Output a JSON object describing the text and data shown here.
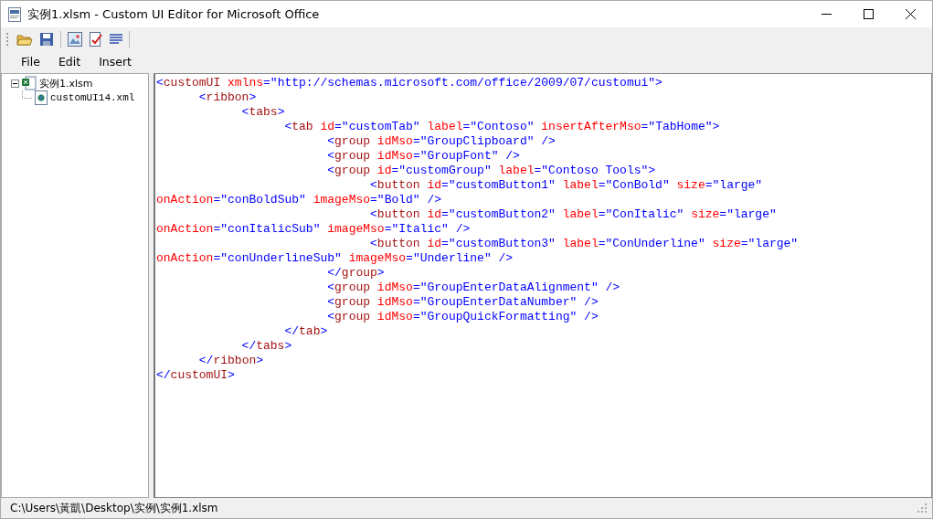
{
  "window": {
    "title": "实例1.xlsm - Custom UI Editor for Microsoft Office"
  },
  "menu": [
    "File",
    "Edit",
    "Insert"
  ],
  "tree": [
    {
      "label": "实例1.xlsm",
      "expanded": true,
      "children": [
        {
          "label": "customUI14.xml"
        }
      ]
    }
  ],
  "code_lines": [
    [
      {
        "kind": "punct",
        "text": "<"
      },
      {
        "kind": "tag",
        "text": "customUI"
      },
      {
        "kind": "attr",
        "text": " xmlns"
      },
      {
        "kind": "punct",
        "text": "=\"http://schemas.microsoft.com/office/2009/07/customui\">"
      }
    ],
    [
      {
        "kind": "punct",
        "text": "      <"
      },
      {
        "kind": "tag",
        "text": "ribbon"
      },
      {
        "kind": "punct",
        "text": ">"
      }
    ],
    [
      {
        "kind": "punct",
        "text": "            <"
      },
      {
        "kind": "tag",
        "text": "tabs"
      },
      {
        "kind": "punct",
        "text": ">"
      }
    ],
    [
      {
        "kind": "punct",
        "text": "                  <"
      },
      {
        "kind": "tag",
        "text": "tab"
      },
      {
        "kind": "attr",
        "text": " id"
      },
      {
        "kind": "punct",
        "text": "=\"customTab\""
      },
      {
        "kind": "attr",
        "text": " label"
      },
      {
        "kind": "punct",
        "text": "=\"Contoso\""
      },
      {
        "kind": "attr",
        "text": " insertAfterMso"
      },
      {
        "kind": "punct",
        "text": "=\"TabHome\">"
      }
    ],
    [
      {
        "kind": "punct",
        "text": "                        <"
      },
      {
        "kind": "tag",
        "text": "group"
      },
      {
        "kind": "attr",
        "text": " idMso"
      },
      {
        "kind": "punct",
        "text": "=\"GroupClipboard\" />"
      }
    ],
    [
      {
        "kind": "punct",
        "text": "                        <"
      },
      {
        "kind": "tag",
        "text": "group"
      },
      {
        "kind": "attr",
        "text": " idMso"
      },
      {
        "kind": "punct",
        "text": "=\"GroupFont\" />"
      }
    ],
    [
      {
        "kind": "punct",
        "text": "                        <"
      },
      {
        "kind": "tag",
        "text": "group"
      },
      {
        "kind": "attr",
        "text": " id"
      },
      {
        "kind": "punct",
        "text": "=\"customGroup\""
      },
      {
        "kind": "attr",
        "text": " label"
      },
      {
        "kind": "punct",
        "text": "=\"Contoso Tools\">"
      }
    ],
    [
      {
        "kind": "punct",
        "text": "                              <"
      },
      {
        "kind": "tag",
        "text": "button"
      },
      {
        "kind": "attr",
        "text": " id"
      },
      {
        "kind": "punct",
        "text": "=\"customButton1\""
      },
      {
        "kind": "attr",
        "text": " label"
      },
      {
        "kind": "punct",
        "text": "=\"ConBold\""
      },
      {
        "kind": "attr",
        "text": " size"
      },
      {
        "kind": "punct",
        "text": "=\"large\""
      }
    ],
    [
      {
        "kind": "attr",
        "text": "onAction"
      },
      {
        "kind": "punct",
        "text": "=\"conBoldSub\""
      },
      {
        "kind": "attr",
        "text": " imageMso"
      },
      {
        "kind": "punct",
        "text": "=\"Bold\" />"
      }
    ],
    [
      {
        "kind": "punct",
        "text": "                              <"
      },
      {
        "kind": "tag",
        "text": "button"
      },
      {
        "kind": "attr",
        "text": " id"
      },
      {
        "kind": "punct",
        "text": "=\"customButton2\""
      },
      {
        "kind": "attr",
        "text": " label"
      },
      {
        "kind": "punct",
        "text": "=\"ConItalic\""
      },
      {
        "kind": "attr",
        "text": " size"
      },
      {
        "kind": "punct",
        "text": "=\"large\""
      }
    ],
    [
      {
        "kind": "attr",
        "text": "onAction"
      },
      {
        "kind": "punct",
        "text": "=\"conItalicSub\""
      },
      {
        "kind": "attr",
        "text": " imageMso"
      },
      {
        "kind": "punct",
        "text": "=\"Italic\" />"
      }
    ],
    [
      {
        "kind": "punct",
        "text": "                              <"
      },
      {
        "kind": "tag",
        "text": "button"
      },
      {
        "kind": "attr",
        "text": " id"
      },
      {
        "kind": "punct",
        "text": "=\"customButton3\""
      },
      {
        "kind": "attr",
        "text": " label"
      },
      {
        "kind": "punct",
        "text": "=\"ConUnderline\""
      },
      {
        "kind": "attr",
        "text": " size"
      },
      {
        "kind": "punct",
        "text": "=\"large\""
      }
    ],
    [
      {
        "kind": "attr",
        "text": "onAction"
      },
      {
        "kind": "punct",
        "text": "=\"conUnderlineSub\""
      },
      {
        "kind": "attr",
        "text": " imageMso"
      },
      {
        "kind": "punct",
        "text": "=\"Underline\" />"
      }
    ],
    [
      {
        "kind": "punct",
        "text": "                        </"
      },
      {
        "kind": "tag",
        "text": "group"
      },
      {
        "kind": "punct",
        "text": ">"
      }
    ],
    [
      {
        "kind": "punct",
        "text": "                        <"
      },
      {
        "kind": "tag",
        "text": "group"
      },
      {
        "kind": "attr",
        "text": " idMso"
      },
      {
        "kind": "punct",
        "text": "=\"GroupEnterDataAlignment\" />"
      }
    ],
    [
      {
        "kind": "punct",
        "text": "                        <"
      },
      {
        "kind": "tag",
        "text": "group"
      },
      {
        "kind": "attr",
        "text": " idMso"
      },
      {
        "kind": "punct",
        "text": "=\"GroupEnterDataNumber\" />"
      }
    ],
    [
      {
        "kind": "punct",
        "text": "                        <"
      },
      {
        "kind": "tag",
        "text": "group"
      },
      {
        "kind": "attr",
        "text": " idMso"
      },
      {
        "kind": "punct",
        "text": "=\"GroupQuickFormatting\" />"
      }
    ],
    [
      {
        "kind": "punct",
        "text": "                  </"
      },
      {
        "kind": "tag",
        "text": "tab"
      },
      {
        "kind": "punct",
        "text": ">"
      }
    ],
    [
      {
        "kind": "punct",
        "text": "            </"
      },
      {
        "kind": "tag",
        "text": "tabs"
      },
      {
        "kind": "punct",
        "text": ">"
      }
    ],
    [
      {
        "kind": "punct",
        "text": "      </"
      },
      {
        "kind": "tag",
        "text": "ribbon"
      },
      {
        "kind": "punct",
        "text": ">"
      }
    ],
    [
      {
        "kind": "punct",
        "text": "</"
      },
      {
        "kind": "tag",
        "text": "customUI"
      },
      {
        "kind": "punct",
        "text": ">"
      }
    ]
  ],
  "status_bar": "C:\\Users\\黃凱\\Desktop\\实例\\实例1.xlsm"
}
